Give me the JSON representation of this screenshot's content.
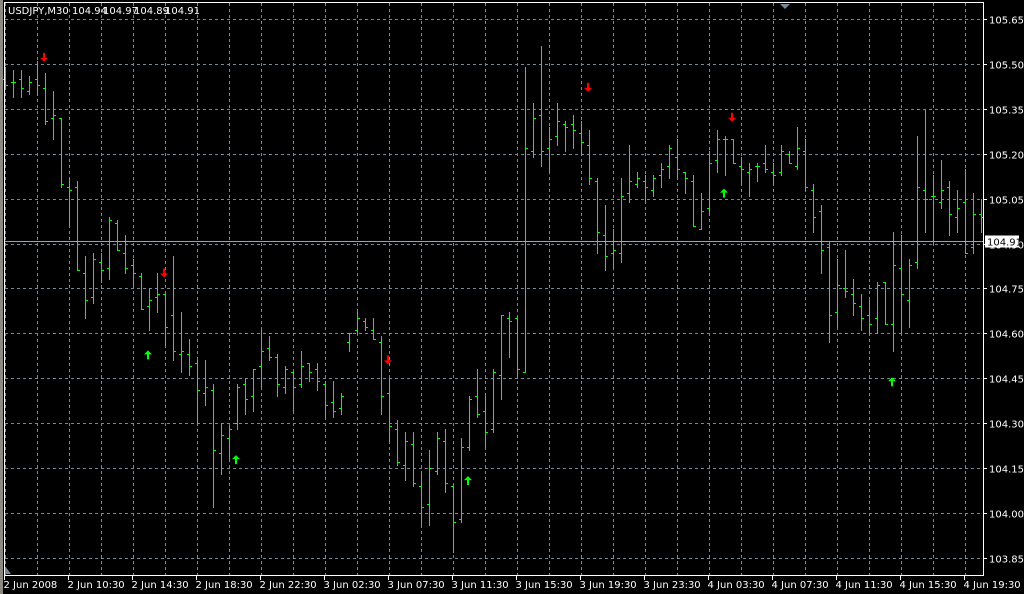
{
  "header": {
    "symbol_timeframe": "USDJPY,M30",
    "open": "104.94",
    "high": "104.97",
    "low": "104.89",
    "close": "104.91"
  },
  "colors": {
    "background": "#000000",
    "bars": "#00ff00",
    "grid": "#778899",
    "sell_arrow": "#ff0000",
    "buy_arrow": "#00ff00",
    "axis": "#ffffff"
  },
  "chart_data": {
    "type": "ohlc",
    "title": "USDJPY,M30",
    "ylim": [
      103.85,
      105.65
    ],
    "y_ticks": [
      "105.65",
      "105.50",
      "105.35",
      "105.20",
      "105.05",
      "104.90",
      "104.75",
      "104.60",
      "104.45",
      "104.30",
      "104.15",
      "104.00",
      "103.85"
    ],
    "y_tick_values": [
      105.65,
      105.5,
      105.35,
      105.2,
      105.05,
      104.9,
      104.75,
      104.6,
      104.45,
      104.3,
      104.15,
      104.0,
      103.85
    ],
    "x_ticks": [
      "2 Jun 2008",
      "2 Jun 10:30",
      "2 Jun 14:30",
      "2 Jun 18:30",
      "2 Jun 22:30",
      "3 Jun 02:30",
      "3 Jun 07:30",
      "3 Jun 11:30",
      "3 Jun 15:30",
      "3 Jun 19:30",
      "3 Jun 23:30",
      "4 Jun 03:30",
      "4 Jun 07:30",
      "4 Jun 11:30",
      "4 Jun 15:30",
      "4 Jun 19:30"
    ],
    "bars_per_x_tick": 8,
    "current_price": "104.91",
    "grid": true,
    "ohlc": [
      [
        105.45,
        105.49,
        105.42,
        105.43
      ],
      [
        105.44,
        105.48,
        105.39,
        105.44
      ],
      [
        105.45,
        105.48,
        105.39,
        105.42
      ],
      [
        105.41,
        105.46,
        105.4,
        105.44
      ],
      [
        105.45,
        105.51,
        105.4,
        105.43
      ],
      [
        105.42,
        105.47,
        105.3,
        105.31
      ],
      [
        105.32,
        105.41,
        105.25,
        105.33
      ],
      [
        105.32,
        105.32,
        105.09,
        105.1
      ],
      [
        105.09,
        105.12,
        104.96,
        105.08
      ],
      [
        105.09,
        105.11,
        104.81,
        104.81
      ],
      [
        104.8,
        104.86,
        104.65,
        104.71
      ],
      [
        104.72,
        104.87,
        104.7,
        104.85
      ],
      [
        104.84,
        104.87,
        104.77,
        104.81
      ],
      [
        104.82,
        104.99,
        104.78,
        104.98
      ],
      [
        104.97,
        104.98,
        104.88,
        104.88
      ],
      [
        104.87,
        104.93,
        104.8,
        104.82
      ],
      [
        104.83,
        104.85,
        104.76,
        104.8
      ],
      [
        104.79,
        104.8,
        104.68,
        104.68
      ],
      [
        104.69,
        104.75,
        104.61,
        104.71
      ],
      [
        104.72,
        104.8,
        104.67,
        104.73
      ],
      [
        104.73,
        104.73,
        104.56,
        104.62
      ],
      [
        104.66,
        104.86,
        104.51,
        104.54
      ],
      [
        104.53,
        104.67,
        104.47,
        104.54
      ],
      [
        104.53,
        104.58,
        104.46,
        104.49
      ],
      [
        104.5,
        104.51,
        104.3,
        104.41
      ],
      [
        104.4,
        104.51,
        104.36,
        104.42
      ],
      [
        104.41,
        104.43,
        104.02,
        104.21
      ],
      [
        104.2,
        104.3,
        104.13,
        104.26
      ],
      [
        104.25,
        104.29,
        104.18,
        104.28
      ],
      [
        104.3,
        104.43,
        104.28,
        104.42
      ],
      [
        104.43,
        104.45,
        104.33,
        104.38
      ],
      [
        104.39,
        104.48,
        104.34,
        104.48
      ],
      [
        104.49,
        104.61,
        104.42,
        104.54
      ],
      [
        104.55,
        104.59,
        104.51,
        104.52
      ],
      [
        104.52,
        104.53,
        104.39,
        104.43
      ],
      [
        104.42,
        104.49,
        104.4,
        104.48
      ],
      [
        104.47,
        104.47,
        104.34,
        104.42
      ],
      [
        104.43,
        104.54,
        104.42,
        104.49
      ],
      [
        104.5,
        104.5,
        104.44,
        104.47
      ],
      [
        104.48,
        104.5,
        104.41,
        104.44
      ],
      [
        104.43,
        104.44,
        104.32,
        104.36
      ],
      [
        104.37,
        104.44,
        104.32,
        104.34
      ],
      [
        104.35,
        104.4,
        104.33,
        104.39
      ],
      [
        104.57,
        104.6,
        104.54,
        104.6
      ],
      [
        104.61,
        104.67,
        104.6,
        104.65
      ],
      [
        104.64,
        104.65,
        104.61,
        104.62
      ],
      [
        104.61,
        104.65,
        104.58,
        104.58
      ],
      [
        104.57,
        104.59,
        104.33,
        104.39
      ],
      [
        104.4,
        104.45,
        104.24,
        104.29
      ],
      [
        104.28,
        104.31,
        104.16,
        104.17
      ],
      [
        104.16,
        104.27,
        104.11,
        104.24
      ],
      [
        104.23,
        104.27,
        104.09,
        104.1
      ],
      [
        104.09,
        104.13,
        103.96,
        104.02
      ],
      [
        104.03,
        104.21,
        103.96,
        104.15
      ],
      [
        104.14,
        104.27,
        104.13,
        104.25
      ],
      [
        104.24,
        104.28,
        104.07,
        104.1
      ],
      [
        104.09,
        104.09,
        103.87,
        103.97
      ],
      [
        103.98,
        104.25,
        103.97,
        104.22
      ],
      [
        104.22,
        104.39,
        104.21,
        104.38
      ],
      [
        104.39,
        104.48,
        104.32,
        104.33
      ],
      [
        104.34,
        104.39,
        104.22,
        104.27
      ],
      [
        104.28,
        104.48,
        104.27,
        104.47
      ],
      [
        104.46,
        104.66,
        104.38,
        104.66
      ],
      [
        104.65,
        104.67,
        104.52,
        104.64
      ],
      [
        104.65,
        104.65,
        104.45,
        104.48
      ],
      [
        104.47,
        105.49,
        104.47,
        105.22
      ],
      [
        105.21,
        105.37,
        105.19,
        105.32
      ],
      [
        105.33,
        105.56,
        105.16,
        105.21
      ],
      [
        105.22,
        105.29,
        105.14,
        105.25
      ],
      [
        105.26,
        105.37,
        105.23,
        105.31
      ],
      [
        105.3,
        105.31,
        105.21,
        105.29
      ],
      [
        105.3,
        105.33,
        105.22,
        105.28
      ],
      [
        105.27,
        105.31,
        105.2,
        105.24
      ],
      [
        105.23,
        105.28,
        105.1,
        105.12
      ],
      [
        105.11,
        105.12,
        104.87,
        104.94
      ],
      [
        104.93,
        105.03,
        104.81,
        104.86
      ],
      [
        104.87,
        104.95,
        104.82,
        104.88
      ],
      [
        104.87,
        105.12,
        104.84,
        105.06
      ],
      [
        105.07,
        105.23,
        105.04,
        105.11
      ],
      [
        105.1,
        105.14,
        105.09,
        105.12
      ],
      [
        105.11,
        105.13,
        105.04,
        105.09
      ],
      [
        105.08,
        105.13,
        105.06,
        105.12
      ],
      [
        105.13,
        105.17,
        105.09,
        105.15
      ],
      [
        105.16,
        105.23,
        105.12,
        105.22
      ],
      [
        105.19,
        105.25,
        105.12,
        105.15
      ],
      [
        105.14,
        105.14,
        105.07,
        105.12
      ],
      [
        105.11,
        105.13,
        104.96,
        104.96
      ],
      [
        104.95,
        105.07,
        104.95,
        105.01
      ],
      [
        105.02,
        105.21,
        105.0,
        105.17
      ],
      [
        105.18,
        105.28,
        105.14,
        105.25
      ],
      [
        105.25,
        105.26,
        105.13,
        105.25
      ],
      [
        105.25,
        105.25,
        105.17,
        105.17
      ],
      [
        105.16,
        105.19,
        105.1,
        105.15
      ],
      [
        105.14,
        105.17,
        105.06,
        105.15
      ],
      [
        105.16,
        105.17,
        105.11,
        105.16
      ],
      [
        105.17,
        105.23,
        105.14,
        105.15
      ],
      [
        105.14,
        105.17,
        105.1,
        105.13
      ],
      [
        105.14,
        105.23,
        105.13,
        105.21
      ],
      [
        105.2,
        105.21,
        105.17,
        105.17
      ],
      [
        105.16,
        105.29,
        105.15,
        105.22
      ],
      [
        105.21,
        105.25,
        105.08,
        105.09
      ],
      [
        105.08,
        105.1,
        104.94,
        104.99
      ],
      [
        105.01,
        105.03,
        104.8,
        104.88
      ],
      [
        104.89,
        104.91,
        104.57,
        104.66
      ],
      [
        104.67,
        104.85,
        104.62,
        104.76
      ],
      [
        104.75,
        104.88,
        104.72,
        104.74
      ],
      [
        104.73,
        104.78,
        104.66,
        104.7
      ],
      [
        104.69,
        104.73,
        104.61,
        104.65
      ],
      [
        104.66,
        104.71,
        104.6,
        104.63
      ],
      [
        104.65,
        104.77,
        104.6,
        104.76
      ],
      [
        104.77,
        104.77,
        104.63,
        104.63
      ],
      [
        104.63,
        104.94,
        104.54,
        104.83
      ],
      [
        104.82,
        104.93,
        104.6,
        104.73
      ],
      [
        104.71,
        104.85,
        104.62,
        104.83
      ],
      [
        104.84,
        105.26,
        104.82,
        105.09
      ],
      [
        105.08,
        105.35,
        104.94,
        105.05
      ],
      [
        105.06,
        105.13,
        104.9,
        105.06
      ],
      [
        105.04,
        105.18,
        105.02,
        105.08
      ],
      [
        105.09,
        105.11,
        104.93,
        105.0
      ],
      [
        104.99,
        105.08,
        104.94,
        105.02
      ],
      [
        105.04,
        105.15,
        104.87,
        104.87
      ],
      [
        104.89,
        105.07,
        104.87,
        105.0
      ],
      [
        105.0,
        105.05,
        104.94,
        104.99
      ]
    ],
    "signals": [
      {
        "type": "sell",
        "bar": 5,
        "price": 105.52
      },
      {
        "type": "sell",
        "bar": 20,
        "price": 104.8
      },
      {
        "type": "sell",
        "bar": 48,
        "price": 104.51
      },
      {
        "type": "sell",
        "bar": 73,
        "price": 105.42
      },
      {
        "type": "sell",
        "bar": 91,
        "price": 105.32
      },
      {
        "type": "buy",
        "bar": 18,
        "price": 104.53
      },
      {
        "type": "buy",
        "bar": 29,
        "price": 104.18
      },
      {
        "type": "buy",
        "bar": 58,
        "price": 104.11
      },
      {
        "type": "buy",
        "bar": 90,
        "price": 105.07
      },
      {
        "type": "buy",
        "bar": 111,
        "price": 104.44
      }
    ]
  }
}
